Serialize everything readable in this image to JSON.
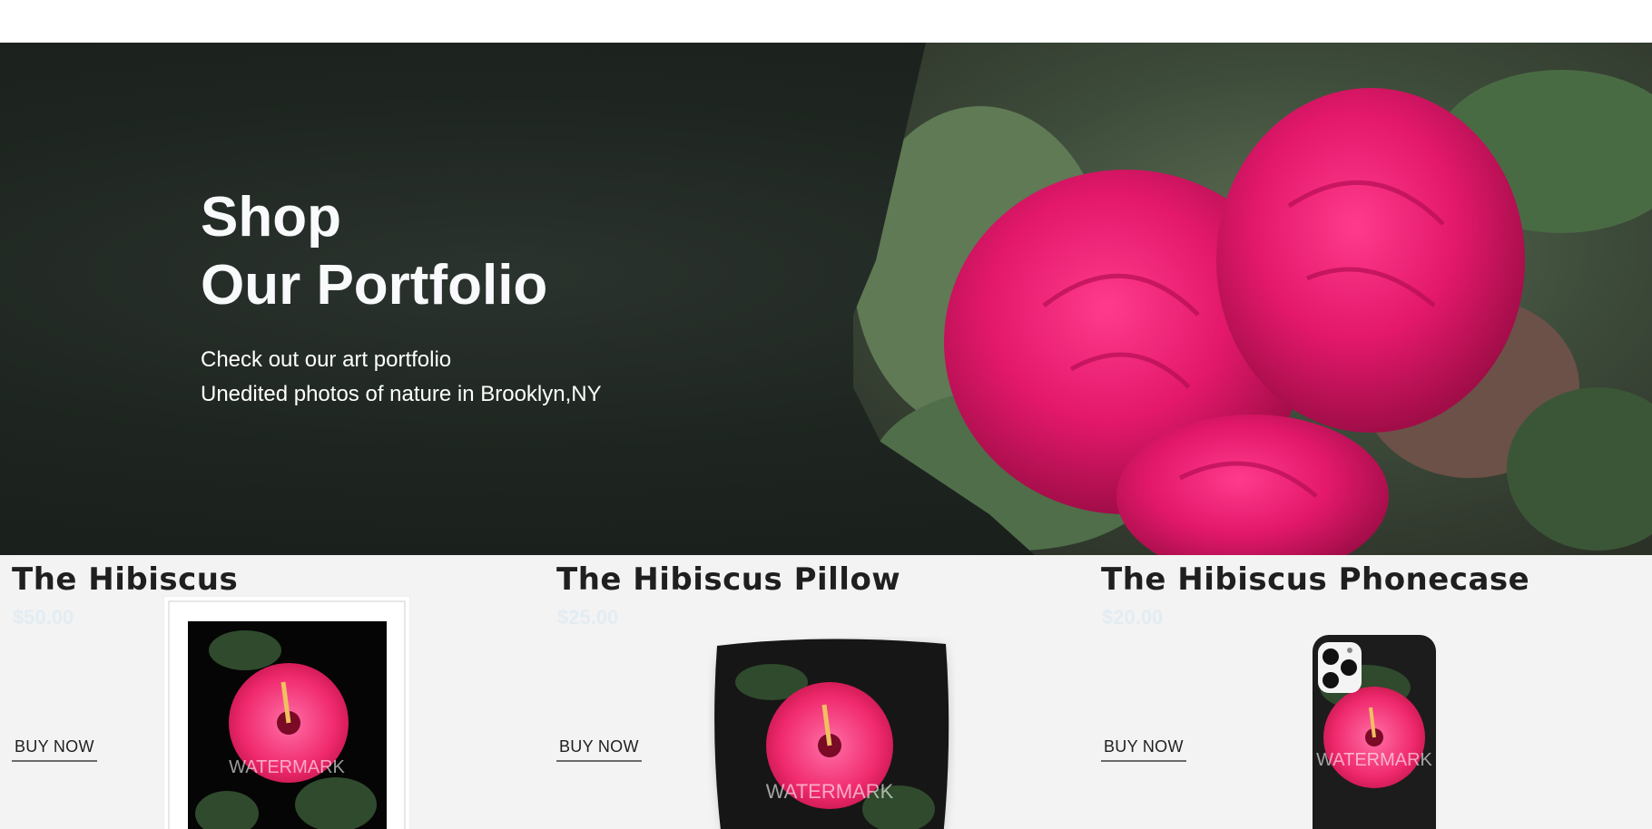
{
  "hero": {
    "title_line1": "Shop",
    "title_line2": "Our Portfolio",
    "subtitle_line1": "Check out our art portfolio",
    "subtitle_line2": "Unedited photos of nature in Brooklyn,NY"
  },
  "products": [
    {
      "name": "The Hibiscus",
      "price": "$50.00",
      "button": "BUY NOW",
      "image_label": "WATERMARK",
      "image_icon": "framed-print-image"
    },
    {
      "name": "The Hibiscus Pillow",
      "price": "$25.00",
      "button": "BUY NOW",
      "image_label": "WATERMARK",
      "image_icon": "pillow-image"
    },
    {
      "name": "The Hibiscus Phonecase",
      "price": "$20.00",
      "button": "BUY NOW",
      "image_label": "WATERMARK",
      "image_icon": "phonecase-image"
    }
  ],
  "colors": {
    "hero_dark": "#1e2520",
    "rose": "#e3186b",
    "products_bg": "#f3f3f3",
    "title_text": "#1f1f1f"
  }
}
